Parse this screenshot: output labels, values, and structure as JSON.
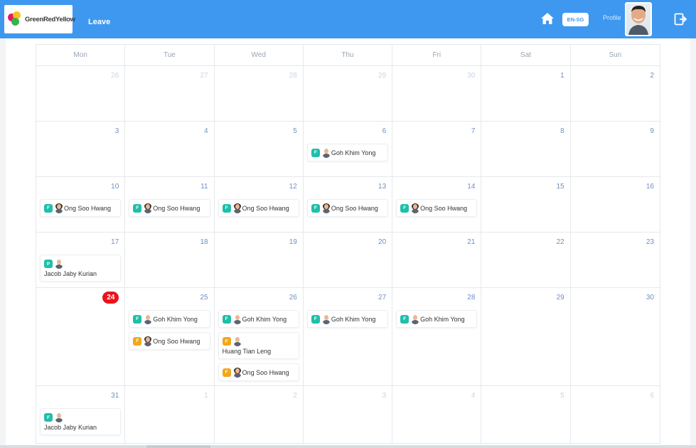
{
  "header": {
    "logo_text": "GreenRedYellow",
    "nav_title": "Leave",
    "language": "EN-SG",
    "profile_label": "Profile"
  },
  "colors": {
    "topbar": "#3e98f0",
    "badge_teal": "#1fbfa9",
    "badge_amber": "#f0a81c",
    "today": "#e9141b"
  },
  "icons": {
    "home": "home-icon",
    "logout": "logout-icon"
  },
  "calendar": {
    "weekdays": [
      "Mon",
      "Tue",
      "Wed",
      "Thu",
      "Fri",
      "Sat",
      "Sun"
    ],
    "weeks": [
      [
        {
          "n": "26",
          "other": true,
          "events": []
        },
        {
          "n": "27",
          "other": true,
          "events": []
        },
        {
          "n": "28",
          "other": true,
          "events": []
        },
        {
          "n": "29",
          "other": true,
          "events": []
        },
        {
          "n": "30",
          "other": true,
          "events": []
        },
        {
          "n": "1",
          "events": []
        },
        {
          "n": "2",
          "events": []
        }
      ],
      [
        {
          "n": "3",
          "events": []
        },
        {
          "n": "4",
          "events": []
        },
        {
          "n": "5",
          "events": []
        },
        {
          "n": "6",
          "events": [
            {
              "badge": "F",
              "color": "#1fbfa9",
              "name": "Goh Khim Yong",
              "g": "m"
            }
          ]
        },
        {
          "n": "7",
          "events": []
        },
        {
          "n": "8",
          "events": []
        },
        {
          "n": "9",
          "events": []
        }
      ],
      [
        {
          "n": "10",
          "events": [
            {
              "badge": "F",
              "color": "#1fbfa9",
              "name": "Ong Soo Hwang",
              "g": "f"
            }
          ]
        },
        {
          "n": "11",
          "events": [
            {
              "badge": "F",
              "color": "#1fbfa9",
              "name": "Ong Soo Hwang",
              "g": "f"
            }
          ]
        },
        {
          "n": "12",
          "events": [
            {
              "badge": "F",
              "color": "#1fbfa9",
              "name": "Ong Soo Hwang",
              "g": "f"
            }
          ]
        },
        {
          "n": "13",
          "events": [
            {
              "badge": "F",
              "color": "#1fbfa9",
              "name": "Ong Soo Hwang",
              "g": "f"
            }
          ]
        },
        {
          "n": "14",
          "events": [
            {
              "badge": "F",
              "color": "#1fbfa9",
              "name": "Ong Soo Hwang",
              "g": "f"
            }
          ]
        },
        {
          "n": "15",
          "events": []
        },
        {
          "n": "16",
          "events": []
        }
      ],
      [
        {
          "n": "17",
          "events": [
            {
              "badge": "P",
              "color": "#1fbfa9",
              "name": "Jacob Jaby Kurian",
              "g": "m",
              "stack": true
            }
          ]
        },
        {
          "n": "18",
          "events": []
        },
        {
          "n": "19",
          "events": []
        },
        {
          "n": "20",
          "events": []
        },
        {
          "n": "21",
          "events": []
        },
        {
          "n": "22",
          "events": []
        },
        {
          "n": "23",
          "events": []
        }
      ],
      [
        {
          "n": "24",
          "today": true,
          "events": []
        },
        {
          "n": "25",
          "events": [
            {
              "badge": "F",
              "color": "#1fbfa9",
              "name": "Goh Khim Yong",
              "g": "m"
            },
            {
              "badge": "F",
              "color": "#f0a81c",
              "name": "Ong Soo Hwang",
              "g": "f"
            }
          ]
        },
        {
          "n": "26",
          "events": [
            {
              "badge": "F",
              "color": "#1fbfa9",
              "name": "Goh Khim Yong",
              "g": "m"
            },
            {
              "badge": "F",
              "color": "#f0a81c",
              "name": "Huang Tian Leng",
              "g": "m",
              "stack": true
            },
            {
              "badge": "F",
              "color": "#f0a81c",
              "name": "Ong Soo Hwang",
              "g": "f"
            }
          ]
        },
        {
          "n": "27",
          "events": [
            {
              "badge": "F",
              "color": "#1fbfa9",
              "name": "Goh Khim Yong",
              "g": "m"
            }
          ]
        },
        {
          "n": "28",
          "events": [
            {
              "badge": "F",
              "color": "#1fbfa9",
              "name": "Goh Khim Yong",
              "g": "m"
            }
          ]
        },
        {
          "n": "29",
          "events": []
        },
        {
          "n": "30",
          "events": []
        }
      ],
      [
        {
          "n": "31",
          "events": [
            {
              "badge": "F",
              "color": "#1fbfa9",
              "name": "Jacob Jaby Kurian",
              "g": "m",
              "stack": true
            }
          ]
        },
        {
          "n": "1",
          "other": true,
          "events": []
        },
        {
          "n": "2",
          "other": true,
          "events": []
        },
        {
          "n": "3",
          "other": true,
          "events": []
        },
        {
          "n": "4",
          "other": true,
          "events": []
        },
        {
          "n": "5",
          "other": true,
          "events": []
        },
        {
          "n": "6",
          "other": true,
          "events": []
        }
      ]
    ]
  }
}
